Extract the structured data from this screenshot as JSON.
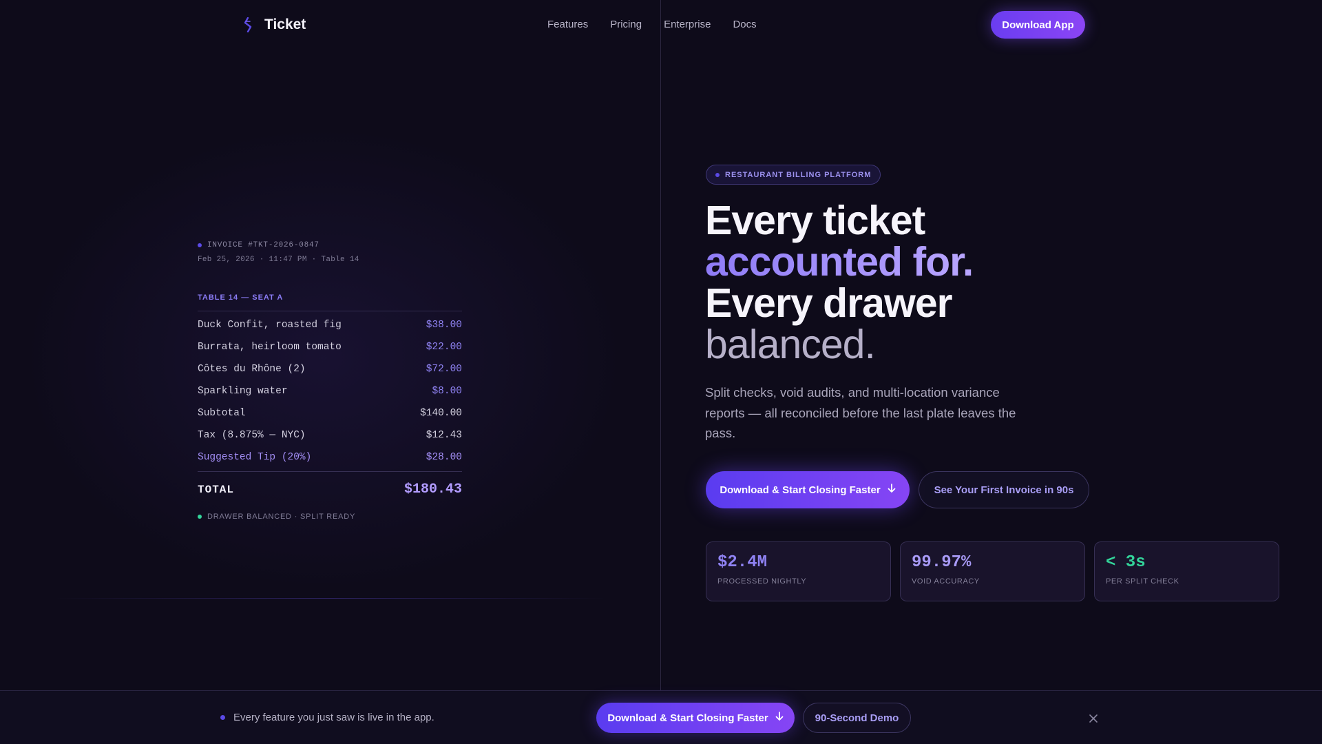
{
  "nav": {
    "logo_text": "Ticket",
    "links": [
      "Features",
      "Pricing",
      "Enterprise",
      "Docs"
    ],
    "cta_label": "Download App"
  },
  "receipt": {
    "invoice_id": "INVOICE #TKT-2026-0847",
    "date_line": "Feb 25, 2026 · 11:47 PM · Table 14",
    "section_title": "TABLE 14 — SEAT A",
    "items": [
      {
        "label": "Duck Confit, roasted fig",
        "price": "$38.00"
      },
      {
        "label": "Burrata, heirloom tomato",
        "price": "$22.00"
      },
      {
        "label": "Côtes du Rhône (2)",
        "price": "$72.00"
      },
      {
        "label": "Sparkling water",
        "price": "$8.00"
      }
    ],
    "subtotal": {
      "label": "Subtotal",
      "price": "$140.00"
    },
    "tax": {
      "label": "Tax (8.875% — NYC)",
      "price": "$12.43"
    },
    "tip": {
      "label": "Suggested Tip (20%)",
      "price": "$28.00"
    },
    "total": {
      "label": "TOTAL",
      "price": "$180.43"
    },
    "status": "DRAWER BALANCED · SPLIT READY"
  },
  "hero": {
    "badge": "RESTAURANT BILLING PLATFORM",
    "headline": [
      "Every ticket",
      "accounted for.",
      "Every drawer",
      "balanced."
    ],
    "subtext": "Split checks, void audits, and multi-location variance reports — all reconciled before the last plate leaves the pass.",
    "primary_cta": "Download & Start Closing Faster",
    "secondary_cta": "See Your First Invoice in 90s",
    "stats": [
      {
        "value": "$2.4M",
        "label": "PROCESSED NIGHTLY",
        "color": "#8f82f2"
      },
      {
        "value": "99.97%",
        "label": "VOID ACCURACY",
        "color": "#a89af6"
      },
      {
        "value": "< 3s",
        "label": "PER SPLIT CHECK",
        "color": "#33d49a"
      }
    ]
  },
  "bottombar": {
    "message": "Every feature you just saw is live in the app.",
    "primary_cta": "Download & Start Closing Faster",
    "secondary_cta": "90-Second Demo"
  },
  "icons": {
    "logo": "ticket-logo-icon",
    "arrow": "arrow-down-icon",
    "close": "close-icon"
  }
}
